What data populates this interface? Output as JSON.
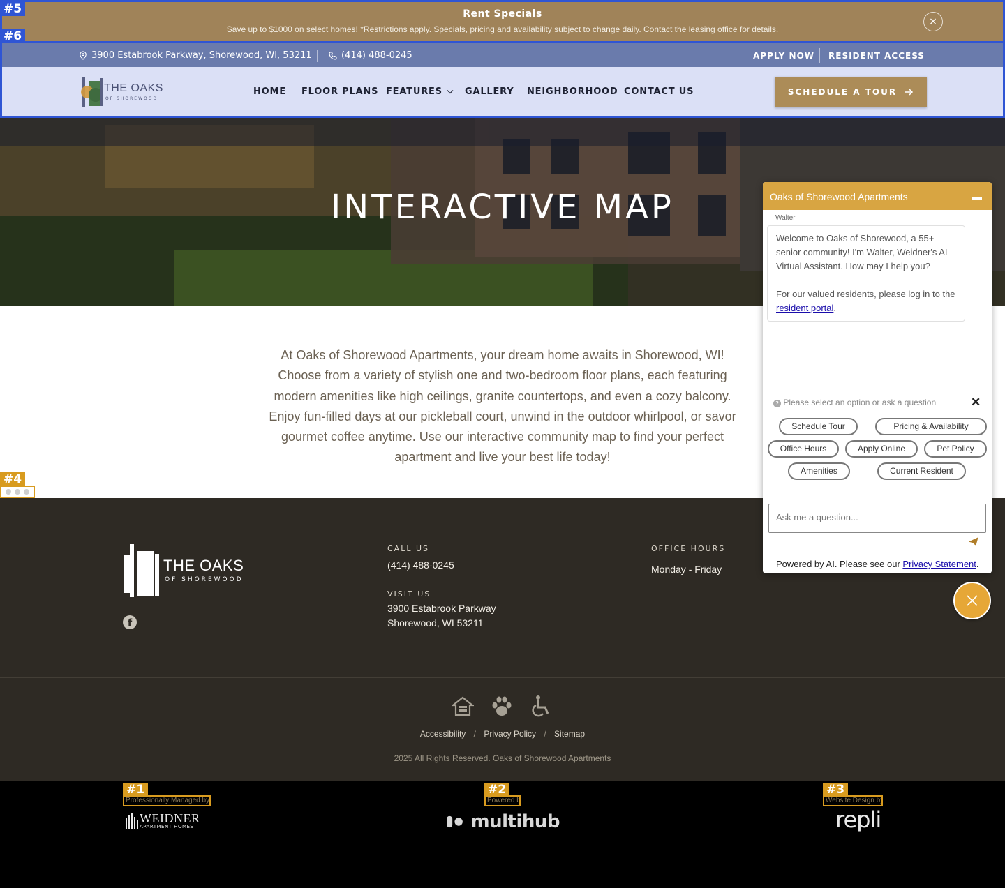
{
  "specials": {
    "title": "Rent Specials",
    "text": "Save up to $1000 on select homes! *Restrictions apply. Specials, pricing and availability subject to change daily. Contact the leasing office for details.",
    "close_icon": "×"
  },
  "markers": {
    "m1": "#1",
    "m2": "#2",
    "m3": "#3",
    "m4": "#4",
    "m5": "#5",
    "m6": "#6"
  },
  "topbar": {
    "address": "3900 Estabrook Parkway, Shorewood, WI, 53211",
    "phone": "(414) 488-0245",
    "apply": "APPLY NOW",
    "resident": "RESIDENT ACCESS"
  },
  "logo": {
    "name": "THE OAKS",
    "sub": "OF SHOREWOOD"
  },
  "nav": {
    "home": "HOME",
    "floor_plans": "FLOOR PLANS",
    "features": "FEATURES",
    "gallery": "GALLERY",
    "neighborhood": "NEIGHBORHOOD",
    "contact": "CONTACT US"
  },
  "cta": {
    "label": "SCHEDULE A TOUR"
  },
  "hero": {
    "title": "INTERACTIVE MAP"
  },
  "intro": "At Oaks of Shorewood Apartments, your dream home awaits in Shorewood, WI! Choose from a variety of stylish one and two-bedroom floor plans, each featuring modern amenities like high ceilings, granite countertops, and even a cozy balcony. Enjoy fun-filled days at our pickleball court, unwind in the outdoor whirlpool, or savor gourmet coffee anytime. Use our interactive community map to find your perfect apartment and live your best life today!",
  "footer": {
    "logo_name": "THE OAKS",
    "logo_sub": "OF SHOREWOOD",
    "call_label": "CALL US",
    "phone": "(414) 488-0245",
    "visit_label": "VISIT US",
    "address1": "3900 Estabrook Parkway",
    "address2": "Shorewood, WI 53211",
    "hours_label": "OFFICE HOURS",
    "hours_days": "Monday - Friday",
    "links": {
      "accessibility": "Accessibility",
      "privacy": "Privacy Policy",
      "sitemap": "Sitemap",
      "sep": "/"
    },
    "copyright": "2025 All Rights Reserved. Oaks of Shorewood Apartments"
  },
  "bottom": {
    "managed_caption": "Professionally Managed by",
    "managed_name": "WEIDNER",
    "managed_sub": "APARTMENT HOMES",
    "powered_caption": "Powered by",
    "powered_name": "multihub",
    "design_caption": "Website Design by",
    "design_name": "repli"
  },
  "chat": {
    "title": "Oaks of Shorewood Apartments",
    "sender": "Walter",
    "message1": "Welcome to Oaks of Shorewood, a 55+ senior community! I'm Walter, Weidner's AI Virtual Assistant. How may I help you?",
    "message2_prefix": "For our valued residents, please log in to the",
    "message2_link": "resident portal",
    "message2_suffix": ".",
    "prompt": "Please select an option or ask a question",
    "chips": {
      "schedule": "Schedule Tour",
      "pricing": "Pricing & Availability",
      "office": "Office Hours",
      "apply": "Apply Online",
      "pet": "Pet Policy",
      "amenities": "Amenities",
      "current": "Current Resident"
    },
    "input_placeholder": "Ask me a question...",
    "powered_prefix": "Powered by AI. Please see our",
    "powered_link": "Privacy Statement",
    "powered_suffix": "."
  },
  "colors": {
    "gold": "#ac8c58",
    "navy": "#6a7bac",
    "footer": "#2e2a24",
    "chat_head": "#d8a542"
  }
}
